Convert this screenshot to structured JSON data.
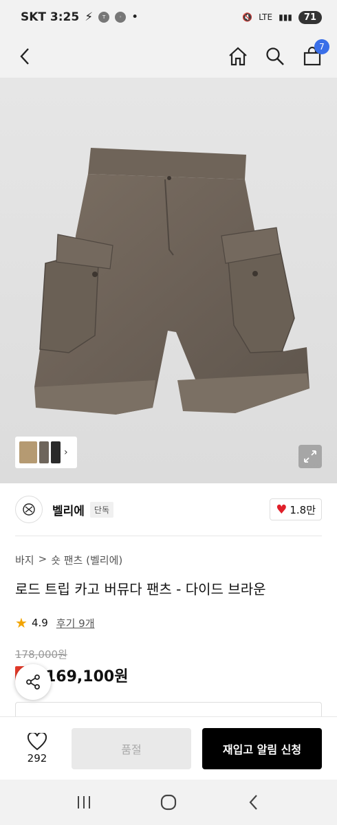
{
  "status_bar": {
    "carrier_time": "SKT 3:25",
    "network": "LTE",
    "battery": "71"
  },
  "header": {
    "cart_count": "7"
  },
  "brand": {
    "name": "벨리에",
    "tag": "단독",
    "likes": "1.8만"
  },
  "breadcrumb": {
    "items": [
      "바지",
      ">",
      "숏 팬츠 (벨리에)"
    ]
  },
  "product": {
    "title": "로드 트립 카고 버뮤다 팬츠 - 다이드 브라운",
    "rating": "4.9",
    "reviews": "후기 9개",
    "original_price": "178,000원",
    "sale_price": "169,100원"
  },
  "bottom_bar": {
    "wish_count": "292",
    "soldout_label": "품절",
    "restock_label": "재입고 알림 신청"
  },
  "colors": {
    "accent": "#3a6fe8",
    "sale": "#e23a2a",
    "heart": "#e0202a",
    "star": "#f2a400"
  }
}
